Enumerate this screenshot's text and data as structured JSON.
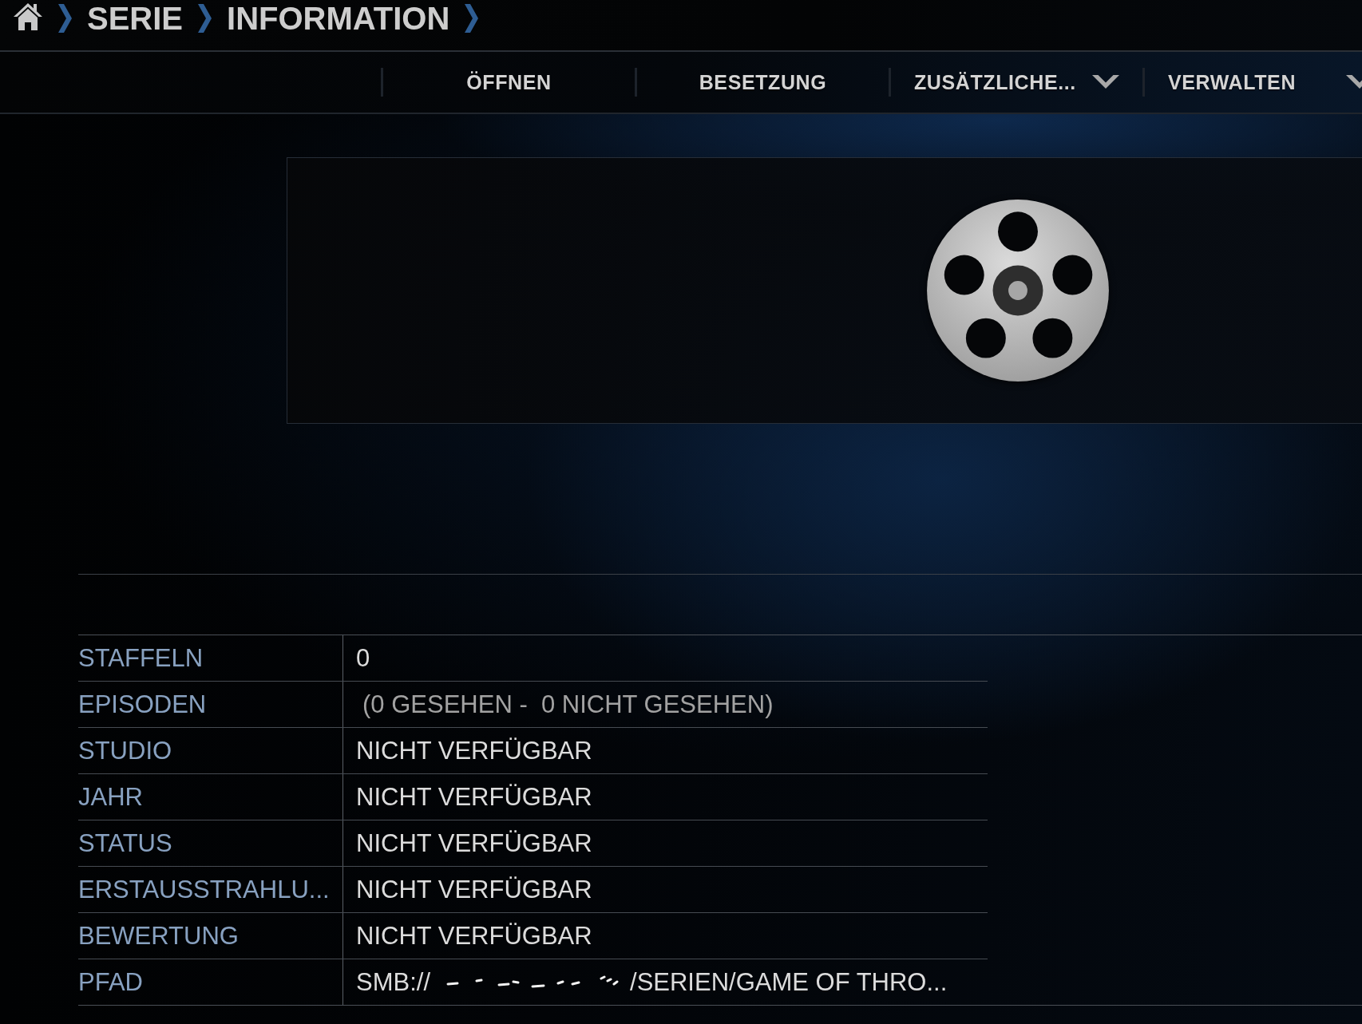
{
  "breadcrumb": {
    "items": [
      {
        "label": "SERIE"
      },
      {
        "label": "INFORMATION"
      }
    ]
  },
  "toolbar": {
    "buttons": [
      {
        "label": "ÖFFNEN",
        "kind": "plain"
      },
      {
        "label": "BESETZUNG",
        "kind": "plain"
      },
      {
        "label": "ZUSÄTZLICHE...",
        "kind": "dropdown"
      },
      {
        "label": "VERWALTEN",
        "kind": "dropdown"
      }
    ]
  },
  "details": {
    "rows": [
      {
        "label": "STAFFELN",
        "value": "0",
        "dimmed": false
      },
      {
        "label": "EPISODEN",
        "value": "(0 GESEHEN -  0 NICHT GESEHEN)",
        "dimmed": true
      },
      {
        "label": "STUDIO",
        "value": "NICHT VERFÜGBAR",
        "dimmed": false
      },
      {
        "label": "JAHR",
        "value": "NICHT VERFÜGBAR",
        "dimmed": false
      },
      {
        "label": "STATUS",
        "value": "NICHT VERFÜGBAR",
        "dimmed": false
      },
      {
        "label": "ERSTAUSSTRAHLU...",
        "value": "NICHT VERFÜGBAR",
        "dimmed": false
      },
      {
        "label": "BEWERTUNG",
        "value": "NICHT VERFÜGBAR",
        "dimmed": false
      },
      {
        "label": "PFAD",
        "value": "SMB://",
        "value_end": "/SERIEN/GAME OF THRO...",
        "dimmed": false
      }
    ]
  }
}
